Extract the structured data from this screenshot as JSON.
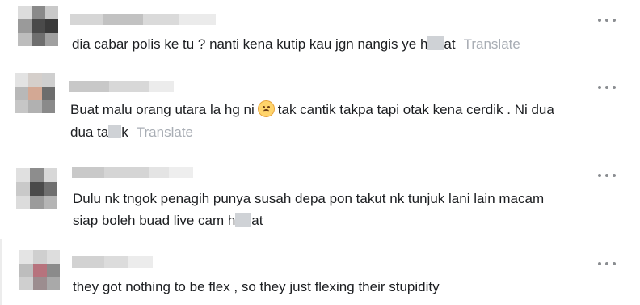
{
  "comments": [
    {
      "text": "dia cabar polis ke tu ? nanti kena kutip kau jgn nangis ye h",
      "text_tail": "at",
      "translate": "Translate"
    },
    {
      "text": "Buat malu orang utara la hg ni",
      "emoji": "pleading-face-icon",
      "text_after_emoji": "tak cantik takpa tapi otak kena cerdik . Ni dua",
      "line2": "dua ta",
      "line2_tail": "k",
      "translate": "Translate"
    },
    {
      "text": "Dulu nk tngok penagih punya susah depa pon takut nk tunjuk lani lain macam",
      "line2": "siap boleh buad live cam h",
      "line2_tail": "at"
    },
    {
      "text": "they got nothing to be flex , so they just flexing their stupidity"
    }
  ],
  "icons": {
    "more": "more-options-icon"
  }
}
